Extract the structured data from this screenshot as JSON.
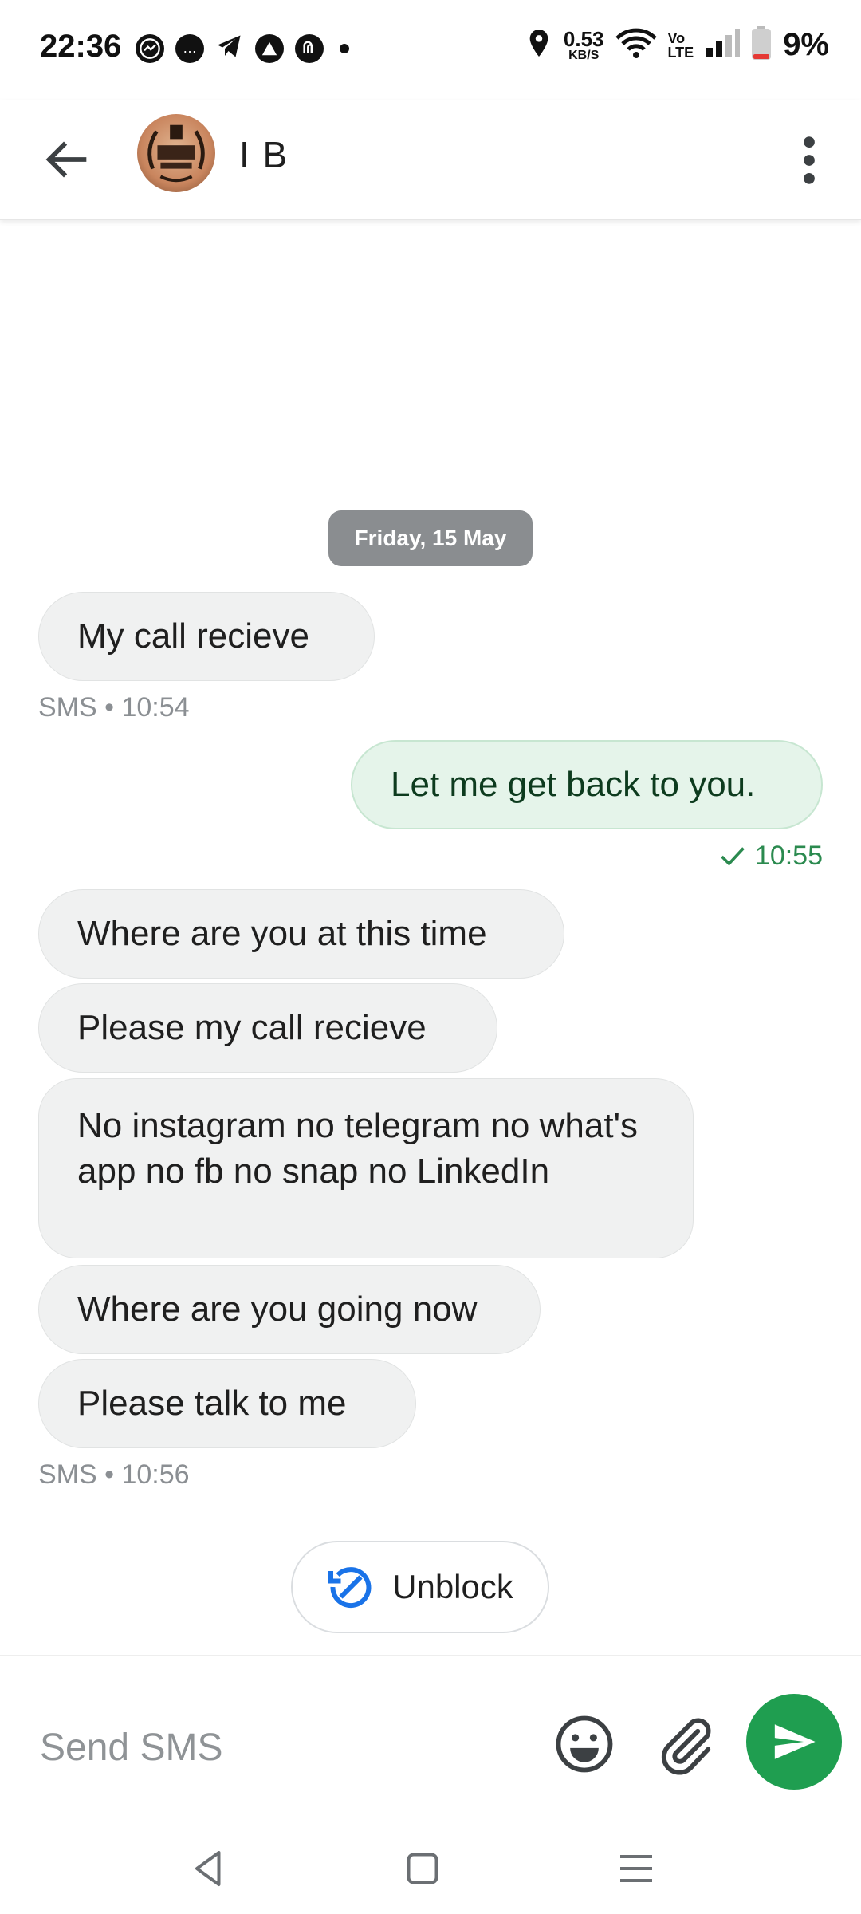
{
  "status_bar": {
    "time": "22:36",
    "speed_value": "0.53",
    "speed_unit": "KB/S",
    "volte_top": "Vo",
    "volte_bottom": "LTE",
    "battery": "9%"
  },
  "header": {
    "contact_name": "I B"
  },
  "conversation": {
    "date_chip": "Friday, 15 May",
    "messages": [
      {
        "text": "My call recieve"
      },
      {
        "text": "Let me get back to you."
      },
      {
        "text": "Where are you at this time"
      },
      {
        "text": "Please my call recieve"
      },
      {
        "text": "No instagram no telegram no what's app no fb no snap no LinkedIn"
      },
      {
        "text": "Where are you going now"
      },
      {
        "text": "Please talk to me"
      }
    ],
    "meta_1": "SMS • 10:54",
    "meta_sent": "10:55",
    "meta_2": "SMS • 10:56"
  },
  "unblock": {
    "label": "Unblock"
  },
  "compose": {
    "placeholder": "Send SMS"
  },
  "colors": {
    "accent_green": "#1f9e50",
    "unblock_blue": "#1a73e8"
  }
}
